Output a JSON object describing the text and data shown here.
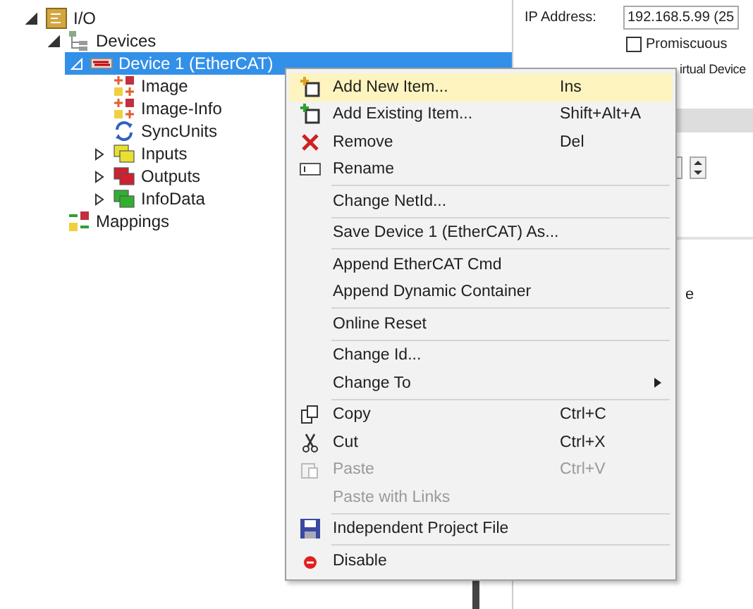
{
  "tree": [
    {
      "label": "I/O",
      "kind": "io",
      "expanded": true,
      "selected": false,
      "children": [
        {
          "label": "Devices",
          "kind": "devices",
          "expanded": true,
          "selected": false,
          "children": [
            {
              "label": "Device 1 (EtherCAT)",
              "kind": "ethercat",
              "expanded": true,
              "selected": true,
              "children": [
                {
                  "label": "Image",
                  "kind": "image",
                  "selected": false
                },
                {
                  "label": "Image-Info",
                  "kind": "image",
                  "selected": false
                },
                {
                  "label": "SyncUnits",
                  "kind": "sync",
                  "selected": false
                },
                {
                  "label": "Inputs",
                  "kind": "inputs",
                  "expanded": false,
                  "selected": false
                },
                {
                  "label": "Outputs",
                  "kind": "outputs",
                  "expanded": false,
                  "selected": false
                },
                {
                  "label": "InfoData",
                  "kind": "infodata",
                  "expanded": false,
                  "selected": false
                }
              ]
            }
          ]
        },
        {
          "label": "Mappings",
          "kind": "mappings",
          "selected": false
        }
      ]
    }
  ],
  "settings": {
    "ip_label": "IP Address:",
    "ip_value": "192.168.5.99 (25",
    "checkboxes": [
      {
        "label": "Promiscuous",
        "checked": false
      }
    ],
    "covered_label": "irtual Device",
    "fragment": "e"
  },
  "context_menu": [
    {
      "kind": "add-new",
      "label": "Add New Item...",
      "shortcut": "Ins",
      "selected": true,
      "disabled": false
    },
    {
      "kind": "add-existing",
      "label": "Add Existing Item...",
      "shortcut": "Shift+Alt+A",
      "selected": false,
      "disabled": false
    },
    {
      "kind": "remove",
      "label": "Remove",
      "shortcut": "Del",
      "selected": false,
      "disabled": false
    },
    {
      "kind": "rename",
      "label": "Rename",
      "selected": false,
      "disabled": false
    },
    {
      "kind": "separator"
    },
    {
      "kind": "plain",
      "label": "Change NetId...",
      "selected": false,
      "disabled": false
    },
    {
      "kind": "separator"
    },
    {
      "kind": "plain",
      "label": "Save Device 1 (EtherCAT) As...",
      "selected": false,
      "disabled": false
    },
    {
      "kind": "separator"
    },
    {
      "kind": "plain",
      "label": "Append EtherCAT Cmd",
      "selected": false,
      "disabled": false
    },
    {
      "kind": "plain",
      "label": "Append Dynamic Container",
      "selected": false,
      "disabled": false
    },
    {
      "kind": "separator"
    },
    {
      "kind": "plain",
      "label": "Online Reset",
      "selected": false,
      "disabled": false
    },
    {
      "kind": "separator"
    },
    {
      "kind": "plain",
      "label": "Change Id...",
      "selected": false,
      "disabled": false
    },
    {
      "kind": "plain",
      "label": "Change To",
      "submenu": true,
      "selected": false,
      "disabled": false
    },
    {
      "kind": "separator"
    },
    {
      "kind": "copy",
      "label": "Copy",
      "shortcut": "Ctrl+C",
      "selected": false,
      "disabled": false
    },
    {
      "kind": "cut",
      "label": "Cut",
      "shortcut": "Ctrl+X",
      "selected": false,
      "disabled": false
    },
    {
      "kind": "paste",
      "label": "Paste",
      "shortcut": "Ctrl+V",
      "selected": false,
      "disabled": true
    },
    {
      "kind": "plain",
      "label": "Paste with Links",
      "selected": false,
      "disabled": true
    },
    {
      "kind": "separator"
    },
    {
      "kind": "save",
      "label": "Independent Project File",
      "selected": false,
      "disabled": false
    },
    {
      "kind": "separator"
    },
    {
      "kind": "disable",
      "label": "Disable",
      "selected": false,
      "disabled": false
    }
  ]
}
